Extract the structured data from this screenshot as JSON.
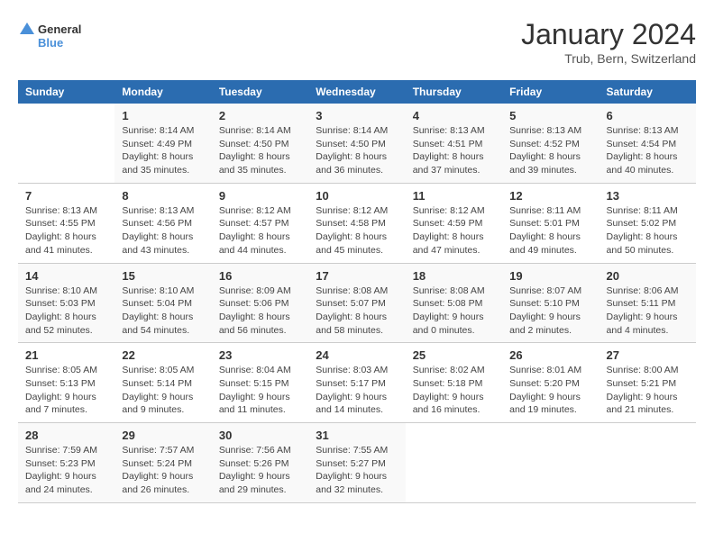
{
  "header": {
    "logo_line1": "General",
    "logo_line2": "Blue",
    "month": "January 2024",
    "location": "Trub, Bern, Switzerland"
  },
  "columns": [
    "Sunday",
    "Monday",
    "Tuesday",
    "Wednesday",
    "Thursday",
    "Friday",
    "Saturday"
  ],
  "weeks": [
    [
      {
        "day": "",
        "sunrise": "",
        "sunset": "",
        "daylight": ""
      },
      {
        "day": "1",
        "sunrise": "Sunrise: 8:14 AM",
        "sunset": "Sunset: 4:49 PM",
        "daylight": "Daylight: 8 hours and 35 minutes."
      },
      {
        "day": "2",
        "sunrise": "Sunrise: 8:14 AM",
        "sunset": "Sunset: 4:50 PM",
        "daylight": "Daylight: 8 hours and 35 minutes."
      },
      {
        "day": "3",
        "sunrise": "Sunrise: 8:14 AM",
        "sunset": "Sunset: 4:50 PM",
        "daylight": "Daylight: 8 hours and 36 minutes."
      },
      {
        "day": "4",
        "sunrise": "Sunrise: 8:13 AM",
        "sunset": "Sunset: 4:51 PM",
        "daylight": "Daylight: 8 hours and 37 minutes."
      },
      {
        "day": "5",
        "sunrise": "Sunrise: 8:13 AM",
        "sunset": "Sunset: 4:52 PM",
        "daylight": "Daylight: 8 hours and 39 minutes."
      },
      {
        "day": "6",
        "sunrise": "Sunrise: 8:13 AM",
        "sunset": "Sunset: 4:54 PM",
        "daylight": "Daylight: 8 hours and 40 minutes."
      }
    ],
    [
      {
        "day": "7",
        "sunrise": "Sunrise: 8:13 AM",
        "sunset": "Sunset: 4:55 PM",
        "daylight": "Daylight: 8 hours and 41 minutes."
      },
      {
        "day": "8",
        "sunrise": "Sunrise: 8:13 AM",
        "sunset": "Sunset: 4:56 PM",
        "daylight": "Daylight: 8 hours and 43 minutes."
      },
      {
        "day": "9",
        "sunrise": "Sunrise: 8:12 AM",
        "sunset": "Sunset: 4:57 PM",
        "daylight": "Daylight: 8 hours and 44 minutes."
      },
      {
        "day": "10",
        "sunrise": "Sunrise: 8:12 AM",
        "sunset": "Sunset: 4:58 PM",
        "daylight": "Daylight: 8 hours and 45 minutes."
      },
      {
        "day": "11",
        "sunrise": "Sunrise: 8:12 AM",
        "sunset": "Sunset: 4:59 PM",
        "daylight": "Daylight: 8 hours and 47 minutes."
      },
      {
        "day": "12",
        "sunrise": "Sunrise: 8:11 AM",
        "sunset": "Sunset: 5:01 PM",
        "daylight": "Daylight: 8 hours and 49 minutes."
      },
      {
        "day": "13",
        "sunrise": "Sunrise: 8:11 AM",
        "sunset": "Sunset: 5:02 PM",
        "daylight": "Daylight: 8 hours and 50 minutes."
      }
    ],
    [
      {
        "day": "14",
        "sunrise": "Sunrise: 8:10 AM",
        "sunset": "Sunset: 5:03 PM",
        "daylight": "Daylight: 8 hours and 52 minutes."
      },
      {
        "day": "15",
        "sunrise": "Sunrise: 8:10 AM",
        "sunset": "Sunset: 5:04 PM",
        "daylight": "Daylight: 8 hours and 54 minutes."
      },
      {
        "day": "16",
        "sunrise": "Sunrise: 8:09 AM",
        "sunset": "Sunset: 5:06 PM",
        "daylight": "Daylight: 8 hours and 56 minutes."
      },
      {
        "day": "17",
        "sunrise": "Sunrise: 8:08 AM",
        "sunset": "Sunset: 5:07 PM",
        "daylight": "Daylight: 8 hours and 58 minutes."
      },
      {
        "day": "18",
        "sunrise": "Sunrise: 8:08 AM",
        "sunset": "Sunset: 5:08 PM",
        "daylight": "Daylight: 9 hours and 0 minutes."
      },
      {
        "day": "19",
        "sunrise": "Sunrise: 8:07 AM",
        "sunset": "Sunset: 5:10 PM",
        "daylight": "Daylight: 9 hours and 2 minutes."
      },
      {
        "day": "20",
        "sunrise": "Sunrise: 8:06 AM",
        "sunset": "Sunset: 5:11 PM",
        "daylight": "Daylight: 9 hours and 4 minutes."
      }
    ],
    [
      {
        "day": "21",
        "sunrise": "Sunrise: 8:05 AM",
        "sunset": "Sunset: 5:13 PM",
        "daylight": "Daylight: 9 hours and 7 minutes."
      },
      {
        "day": "22",
        "sunrise": "Sunrise: 8:05 AM",
        "sunset": "Sunset: 5:14 PM",
        "daylight": "Daylight: 9 hours and 9 minutes."
      },
      {
        "day": "23",
        "sunrise": "Sunrise: 8:04 AM",
        "sunset": "Sunset: 5:15 PM",
        "daylight": "Daylight: 9 hours and 11 minutes."
      },
      {
        "day": "24",
        "sunrise": "Sunrise: 8:03 AM",
        "sunset": "Sunset: 5:17 PM",
        "daylight": "Daylight: 9 hours and 14 minutes."
      },
      {
        "day": "25",
        "sunrise": "Sunrise: 8:02 AM",
        "sunset": "Sunset: 5:18 PM",
        "daylight": "Daylight: 9 hours and 16 minutes."
      },
      {
        "day": "26",
        "sunrise": "Sunrise: 8:01 AM",
        "sunset": "Sunset: 5:20 PM",
        "daylight": "Daylight: 9 hours and 19 minutes."
      },
      {
        "day": "27",
        "sunrise": "Sunrise: 8:00 AM",
        "sunset": "Sunset: 5:21 PM",
        "daylight": "Daylight: 9 hours and 21 minutes."
      }
    ],
    [
      {
        "day": "28",
        "sunrise": "Sunrise: 7:59 AM",
        "sunset": "Sunset: 5:23 PM",
        "daylight": "Daylight: 9 hours and 24 minutes."
      },
      {
        "day": "29",
        "sunrise": "Sunrise: 7:57 AM",
        "sunset": "Sunset: 5:24 PM",
        "daylight": "Daylight: 9 hours and 26 minutes."
      },
      {
        "day": "30",
        "sunrise": "Sunrise: 7:56 AM",
        "sunset": "Sunset: 5:26 PM",
        "daylight": "Daylight: 9 hours and 29 minutes."
      },
      {
        "day": "31",
        "sunrise": "Sunrise: 7:55 AM",
        "sunset": "Sunset: 5:27 PM",
        "daylight": "Daylight: 9 hours and 32 minutes."
      },
      {
        "day": "",
        "sunrise": "",
        "sunset": "",
        "daylight": ""
      },
      {
        "day": "",
        "sunrise": "",
        "sunset": "",
        "daylight": ""
      },
      {
        "day": "",
        "sunrise": "",
        "sunset": "",
        "daylight": ""
      }
    ]
  ]
}
